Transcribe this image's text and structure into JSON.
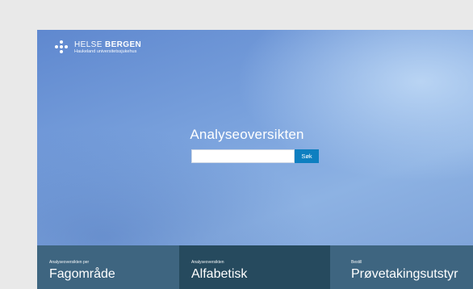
{
  "brand": {
    "title_light": "HELSE",
    "title_bold": "BERGEN",
    "subtitle": "Haukeland universitetssjukehus"
  },
  "main": {
    "title": "Analyseoversikten",
    "search": {
      "value": "",
      "placeholder": "",
      "button_label": "Søk"
    }
  },
  "tiles": [
    {
      "small": "Analyseoversikten per",
      "big": "Fagområde"
    },
    {
      "small": "Analyseoversikten",
      "big": "Alfabetisk"
    },
    {
      "small": "Bestill",
      "big": "Prøvetakingsutstyr"
    }
  ],
  "colors": {
    "page_bg": "#e9e9e9",
    "search_button": "#0e7fc0",
    "tile_light": "#3e6580",
    "tile_dark": "#264a5e"
  }
}
